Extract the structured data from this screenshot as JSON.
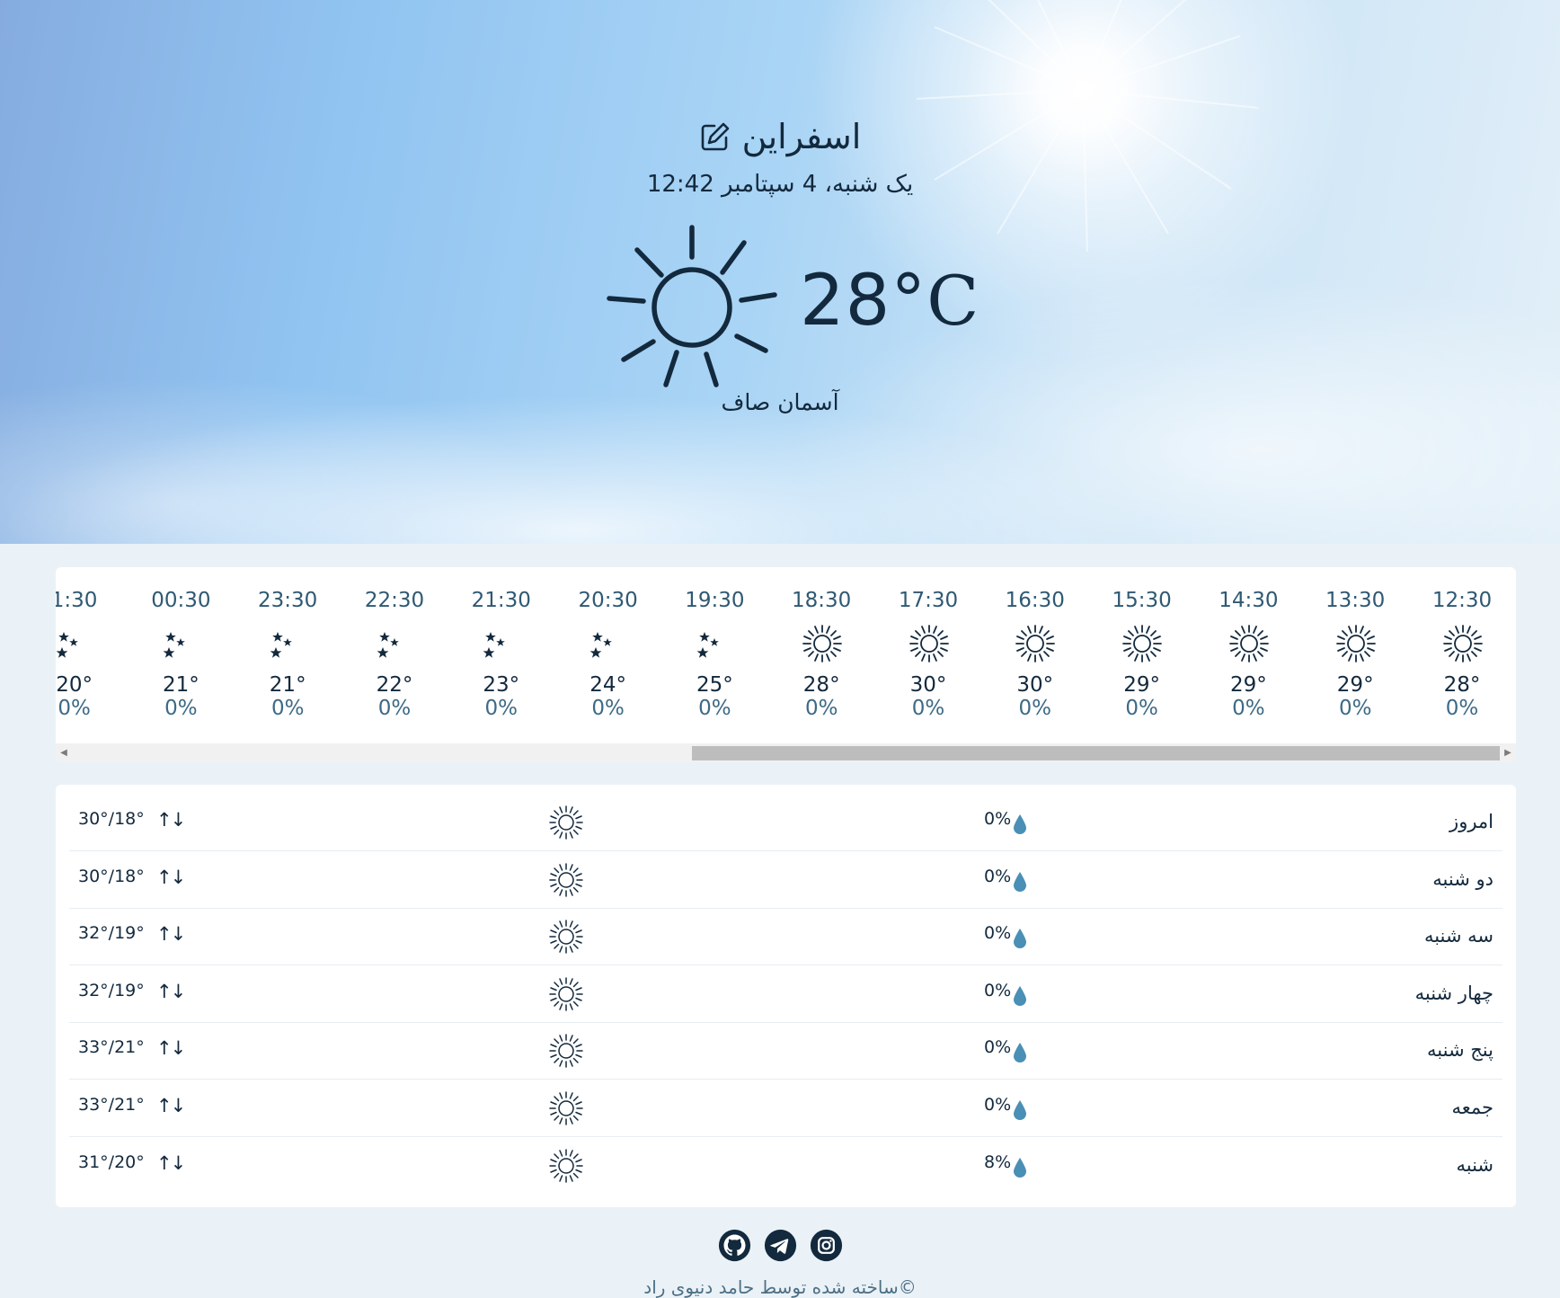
{
  "location": {
    "city": "اسفراین",
    "datetime": "یک شنبه، 4 سپتامبر 12:42"
  },
  "current": {
    "temp": "28°",
    "unit": "C",
    "condition": "آسمان صاف",
    "icon": "sun-icon"
  },
  "hourly": [
    {
      "time": "12:30",
      "icon": "sun-icon",
      "temp": "28°",
      "pop": "0%"
    },
    {
      "time": "13:30",
      "icon": "sun-icon",
      "temp": "29°",
      "pop": "0%"
    },
    {
      "time": "14:30",
      "icon": "sun-icon",
      "temp": "29°",
      "pop": "0%"
    },
    {
      "time": "15:30",
      "icon": "sun-icon",
      "temp": "29°",
      "pop": "0%"
    },
    {
      "time": "16:30",
      "icon": "sun-icon",
      "temp": "30°",
      "pop": "0%"
    },
    {
      "time": "17:30",
      "icon": "sun-icon",
      "temp": "30°",
      "pop": "0%"
    },
    {
      "time": "18:30",
      "icon": "sun-icon",
      "temp": "28°",
      "pop": "0%"
    },
    {
      "time": "19:30",
      "icon": "moon-stars-icon",
      "temp": "25°",
      "pop": "0%"
    },
    {
      "time": "20:30",
      "icon": "moon-stars-icon",
      "temp": "24°",
      "pop": "0%"
    },
    {
      "time": "21:30",
      "icon": "moon-stars-icon",
      "temp": "23°",
      "pop": "0%"
    },
    {
      "time": "22:30",
      "icon": "moon-stars-icon",
      "temp": "22°",
      "pop": "0%"
    },
    {
      "time": "23:30",
      "icon": "moon-stars-icon",
      "temp": "21°",
      "pop": "0%"
    },
    {
      "time": "00:30",
      "icon": "moon-stars-icon",
      "temp": "21°",
      "pop": "0%"
    },
    {
      "time": "1:30",
      "icon": "moon-stars-icon",
      "temp": "20°",
      "pop": "0%"
    }
  ],
  "scroll": {
    "thumb_start": 0.434,
    "thumb_end": 1.0
  },
  "daily": [
    {
      "day": "امروز",
      "pop": "0%",
      "icon": "sun-icon",
      "arrows": "↑↓",
      "range": "30°/18°"
    },
    {
      "day": "دو شنبه",
      "pop": "0%",
      "icon": "sun-icon",
      "arrows": "↑↓",
      "range": "30°/18°"
    },
    {
      "day": "سه شنبه",
      "pop": "0%",
      "icon": "sun-icon",
      "arrows": "↑↓",
      "range": "32°/19°"
    },
    {
      "day": "چهار شنبه",
      "pop": "0%",
      "icon": "sun-icon",
      "arrows": "↑↓",
      "range": "32°/19°"
    },
    {
      "day": "پنج شنبه",
      "pop": "0%",
      "icon": "sun-icon",
      "arrows": "↑↓",
      "range": "33°/21°"
    },
    {
      "day": "جمعه",
      "pop": "0%",
      "icon": "sun-icon",
      "arrows": "↑↓",
      "range": "33°/21°"
    },
    {
      "day": "شنبه",
      "pop": "8%",
      "icon": "sun-icon",
      "arrows": "↑↓",
      "range": "31°/20°"
    }
  ],
  "footer": {
    "social": [
      "github-icon",
      "telegram-icon",
      "instagram-icon"
    ],
    "credit": "©ساخته شده توسط حامد دنیوی راد"
  },
  "colors": {
    "text": "#13293d",
    "drop": "#4a8fb5",
    "background": "#eaf2f7"
  }
}
